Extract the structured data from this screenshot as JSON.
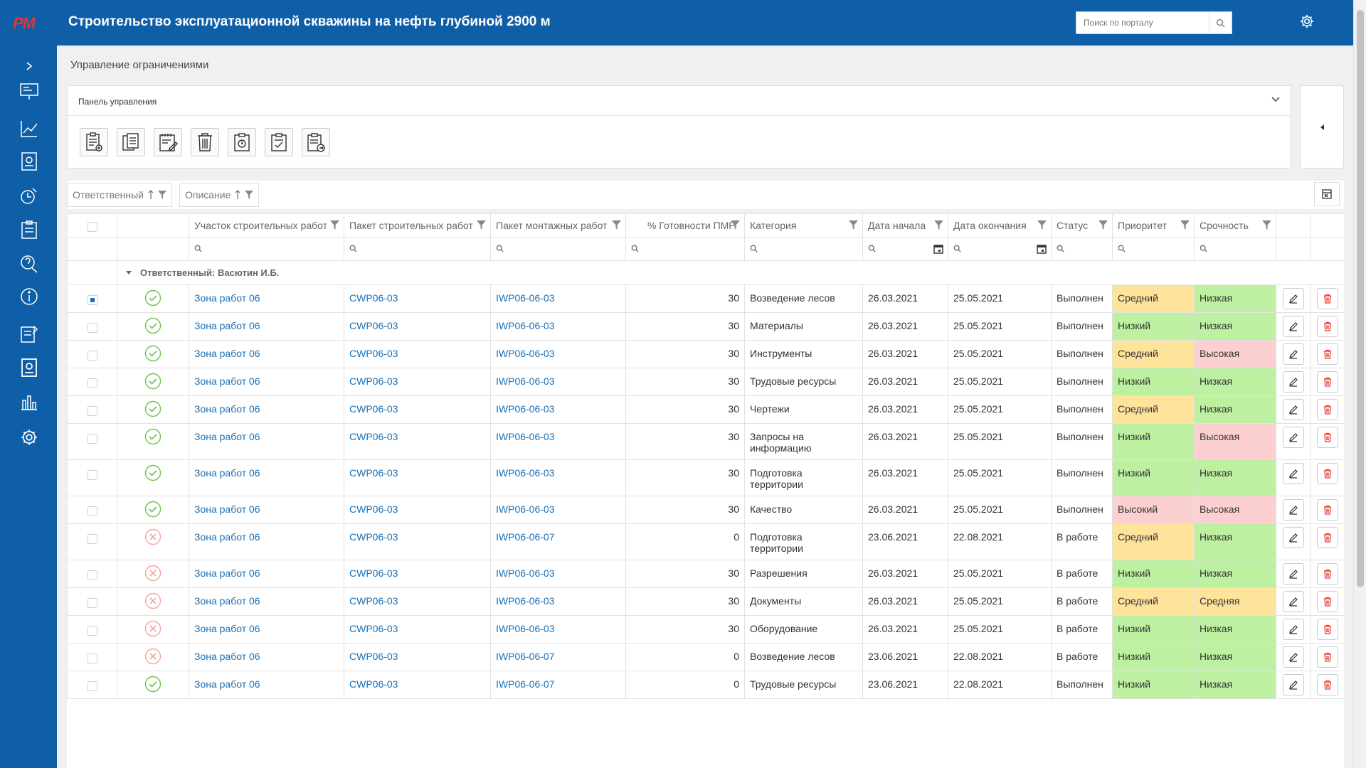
{
  "header": {
    "logo": "РМ",
    "title": "Строительство эксплуатационной скважины на нефть глубиной 2900 м",
    "search_placeholder": "Поиск по порталу"
  },
  "page": {
    "title": "Управление ограничениями"
  },
  "panel": {
    "title": "Панель управления"
  },
  "grouping": {
    "chips": [
      "Ответственный",
      "Описание"
    ]
  },
  "table": {
    "columns": [
      "",
      "",
      "Участок строительных работ",
      "Пакет строительных работ",
      "Пакет монтажных работ",
      "% Готовности ПМР",
      "Категория",
      "Дата начала",
      "Дата окончания",
      "Статус",
      "Приоритет",
      "Срочность",
      "",
      ""
    ],
    "group_label": "Ответственный: Васютин И.Б.",
    "rows": [
      {
        "ok": true,
        "area": "Зона работ 06",
        "cwp": "CWP06-03",
        "iwp": "IWP06-06-03",
        "pct": "30",
        "cat": "Возведение лесов",
        "start": "26.03.2021",
        "end": "25.05.2021",
        "status": "Выполнен",
        "prio": "Средний",
        "urg": "Низкая",
        "sel": true
      },
      {
        "ok": true,
        "area": "Зона работ 06",
        "cwp": "CWP06-03",
        "iwp": "IWP06-06-03",
        "pct": "30",
        "cat": "Материалы",
        "start": "26.03.2021",
        "end": "25.05.2021",
        "status": "Выполнен",
        "prio": "Низкий",
        "urg": "Низкая"
      },
      {
        "ok": true,
        "area": "Зона работ 06",
        "cwp": "CWP06-03",
        "iwp": "IWP06-06-03",
        "pct": "30",
        "cat": "Инструменты",
        "start": "26.03.2021",
        "end": "25.05.2021",
        "status": "Выполнен",
        "prio": "Средний",
        "urg": "Высокая"
      },
      {
        "ok": true,
        "area": "Зона работ 06",
        "cwp": "CWP06-03",
        "iwp": "IWP06-06-03",
        "pct": "30",
        "cat": "Трудовые ресурсы",
        "start": "26.03.2021",
        "end": "25.05.2021",
        "status": "Выполнен",
        "prio": "Низкий",
        "urg": "Низкая"
      },
      {
        "ok": true,
        "area": "Зона работ 06",
        "cwp": "CWP06-03",
        "iwp": "IWP06-06-03",
        "pct": "30",
        "cat": "Чертежи",
        "start": "26.03.2021",
        "end": "25.05.2021",
        "status": "Выполнен",
        "prio": "Средний",
        "urg": "Низкая"
      },
      {
        "ok": true,
        "area": "Зона работ 06",
        "cwp": "CWP06-03",
        "iwp": "IWP06-06-03",
        "pct": "30",
        "cat": "Запросы на информацию",
        "start": "26.03.2021",
        "end": "25.05.2021",
        "status": "Выполнен",
        "prio": "Низкий",
        "urg": "Высокая"
      },
      {
        "ok": true,
        "area": "Зона работ 06",
        "cwp": "CWP06-03",
        "iwp": "IWP06-06-03",
        "pct": "30",
        "cat": "Подготовка территории",
        "start": "26.03.2021",
        "end": "25.05.2021",
        "status": "Выполнен",
        "prio": "Низкий",
        "urg": "Низкая"
      },
      {
        "ok": true,
        "area": "Зона работ 06",
        "cwp": "CWP06-03",
        "iwp": "IWP06-06-03",
        "pct": "30",
        "cat": "Качество",
        "start": "26.03.2021",
        "end": "25.05.2021",
        "status": "Выполнен",
        "prio": "Высокий",
        "urg": "Высокая"
      },
      {
        "ok": false,
        "area": "Зона работ 06",
        "cwp": "CWP06-03",
        "iwp": "IWP06-06-07",
        "pct": "0",
        "cat": "Подготовка территории",
        "start": "23.06.2021",
        "end": "22.08.2021",
        "status": "В работе",
        "prio": "Средний",
        "urg": "Низкая"
      },
      {
        "ok": false,
        "area": "Зона работ 06",
        "cwp": "CWP06-03",
        "iwp": "IWP06-06-03",
        "pct": "30",
        "cat": "Разрешения",
        "start": "26.03.2021",
        "end": "25.05.2021",
        "status": "В работе",
        "prio": "Низкий",
        "urg": "Низкая"
      },
      {
        "ok": false,
        "area": "Зона работ 06",
        "cwp": "CWP06-03",
        "iwp": "IWP06-06-03",
        "pct": "30",
        "cat": "Документы",
        "start": "26.03.2021",
        "end": "25.05.2021",
        "status": "В работе",
        "prio": "Средний",
        "urg": "Средняя"
      },
      {
        "ok": false,
        "area": "Зона работ 06",
        "cwp": "CWP06-03",
        "iwp": "IWP06-06-03",
        "pct": "30",
        "cat": "Оборудование",
        "start": "26.03.2021",
        "end": "25.05.2021",
        "status": "В работе",
        "prio": "Низкий",
        "urg": "Низкая"
      },
      {
        "ok": false,
        "area": "Зона работ 06",
        "cwp": "CWP06-03",
        "iwp": "IWP06-06-07",
        "pct": "0",
        "cat": "Возведение лесов",
        "start": "23.06.2021",
        "end": "22.08.2021",
        "status": "В работе",
        "prio": "Низкий",
        "urg": "Низкая"
      },
      {
        "ok": true,
        "area": "Зона работ 06",
        "cwp": "CWP06-03",
        "iwp": "IWP06-06-07",
        "pct": "0",
        "cat": "Трудовые ресурсы",
        "start": "23.06.2021",
        "end": "22.08.2021",
        "status": "Выполнен",
        "prio": "Низкий",
        "urg": "Низкая"
      }
    ]
  },
  "colors": {
    "header": "#0f5fa8",
    "link": "#1a6fb5",
    "low": "#bdf0a1",
    "mid": "#fde49a",
    "high": "#fcd0d0",
    "ok": "#6cc24a",
    "bad": "#f4a49a",
    "delete": "#e5352c"
  },
  "icons": {
    "status_ok": "check-circle-icon",
    "status_bad": "x-circle-icon",
    "edit": "pencil-icon",
    "delete": "trash-icon"
  }
}
